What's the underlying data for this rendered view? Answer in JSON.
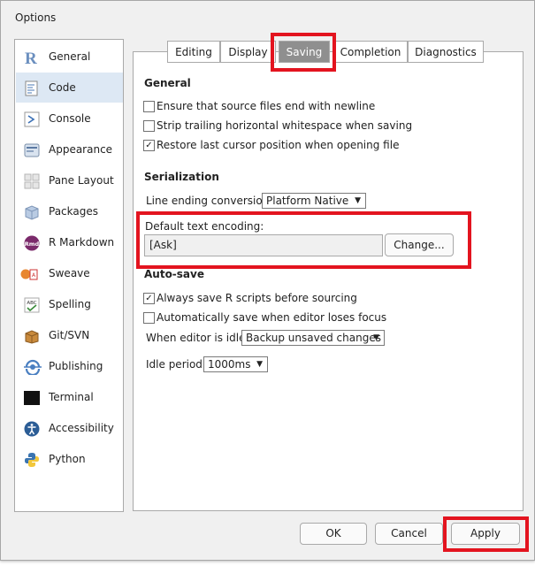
{
  "window": {
    "title": "Options"
  },
  "sidebar": {
    "items": [
      {
        "label": "General",
        "icon": "r-logo-icon"
      },
      {
        "label": "Code",
        "icon": "code-document-icon",
        "active": true
      },
      {
        "label": "Console",
        "icon": "console-prompt-icon"
      },
      {
        "label": "Appearance",
        "icon": "appearance-icon"
      },
      {
        "label": "Pane Layout",
        "icon": "pane-layout-icon"
      },
      {
        "label": "Packages",
        "icon": "package-box-icon"
      },
      {
        "label": "R Markdown",
        "icon": "rmd-icon"
      },
      {
        "label": "Sweave",
        "icon": "sweave-icon"
      },
      {
        "label": "Spelling",
        "icon": "spelling-abc-icon"
      },
      {
        "label": "Git/SVN",
        "icon": "git-box-icon"
      },
      {
        "label": "Publishing",
        "icon": "publishing-icon"
      },
      {
        "label": "Terminal",
        "icon": "terminal-icon"
      },
      {
        "label": "Accessibility",
        "icon": "accessibility-icon"
      },
      {
        "label": "Python",
        "icon": "python-icon"
      }
    ]
  },
  "tabs": [
    {
      "label": "Editing"
    },
    {
      "label": "Display"
    },
    {
      "label": "Saving",
      "active": true
    },
    {
      "label": "Completion"
    },
    {
      "label": "Diagnostics"
    }
  ],
  "general": {
    "heading": "General",
    "options": [
      {
        "label": "Ensure that source files end with newline",
        "checked": false
      },
      {
        "label": "Strip trailing horizontal whitespace when saving",
        "checked": false
      },
      {
        "label": "Restore last cursor position when opening file",
        "checked": true
      }
    ]
  },
  "serialization": {
    "heading": "Serialization",
    "line_ending_label": "Line ending conversion:",
    "line_ending_value": "Platform Native",
    "encoding_label": "Default text encoding:",
    "encoding_value": "[Ask]",
    "change_button": "Change..."
  },
  "autosave": {
    "heading": "Auto-save",
    "options": [
      {
        "label": "Always save R scripts before sourcing",
        "checked": true
      },
      {
        "label": "Automatically save when editor loses focus",
        "checked": false
      }
    ],
    "idle_label": "When editor is idle:",
    "idle_value": "Backup unsaved changes",
    "period_label": "Idle period:",
    "period_value": "1000ms"
  },
  "footer": {
    "ok": "OK",
    "cancel": "Cancel",
    "apply": "Apply"
  },
  "colors": {
    "highlight": "#e3141f",
    "active_tab": "#8f8f8f",
    "active_sidebar": "#dde8f4"
  }
}
